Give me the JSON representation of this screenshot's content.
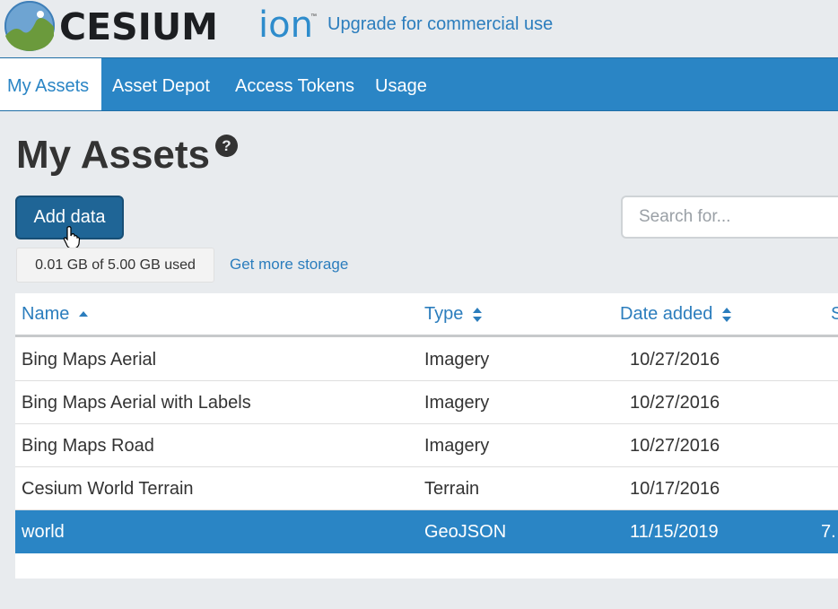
{
  "header": {
    "brand_word": "CESIUM",
    "brand_ion": "ion",
    "trademark": "™",
    "upgrade_link": "Upgrade for commercial use",
    "logo_icon": "cesium-globe-logo"
  },
  "nav": {
    "items": [
      {
        "label": "My Assets",
        "active": true
      },
      {
        "label": "Asset Depot",
        "active": false
      },
      {
        "label": "Access Tokens",
        "active": false
      },
      {
        "label": "Usage",
        "active": false
      }
    ]
  },
  "page": {
    "title": "My Assets",
    "help_icon_glyph": "?",
    "add_button": "Add data",
    "search_placeholder": "Search for...",
    "storage_text": "0.01 GB of 5.00 GB used",
    "storage_link": "Get more storage"
  },
  "table": {
    "columns": [
      {
        "label": "Name",
        "sort": "asc"
      },
      {
        "label": "Type",
        "sort": "both"
      },
      {
        "label": "Date added",
        "sort": "both"
      },
      {
        "label": "S",
        "sort": "none"
      }
    ],
    "rows": [
      {
        "name": "Bing Maps Aerial",
        "type": "Imagery",
        "date": "10/27/2016",
        "size": "",
        "selected": false
      },
      {
        "name": "Bing Maps Aerial with Labels",
        "type": "Imagery",
        "date": "10/27/2016",
        "size": "",
        "selected": false
      },
      {
        "name": "Bing Maps Road",
        "type": "Imagery",
        "date": "10/27/2016",
        "size": "",
        "selected": false
      },
      {
        "name": "Cesium World Terrain",
        "type": "Terrain",
        "date": "10/17/2016",
        "size": "",
        "selected": false
      },
      {
        "name": "world",
        "type": "GeoJSON",
        "date": "11/15/2019",
        "size": "7.",
        "selected": true
      }
    ]
  },
  "colors": {
    "nav_bg": "#2a85c5",
    "accent": "#2b7dbd",
    "button_bg": "#1f6596",
    "selected_row": "#2a85c5",
    "page_bg": "#e8ebee"
  }
}
